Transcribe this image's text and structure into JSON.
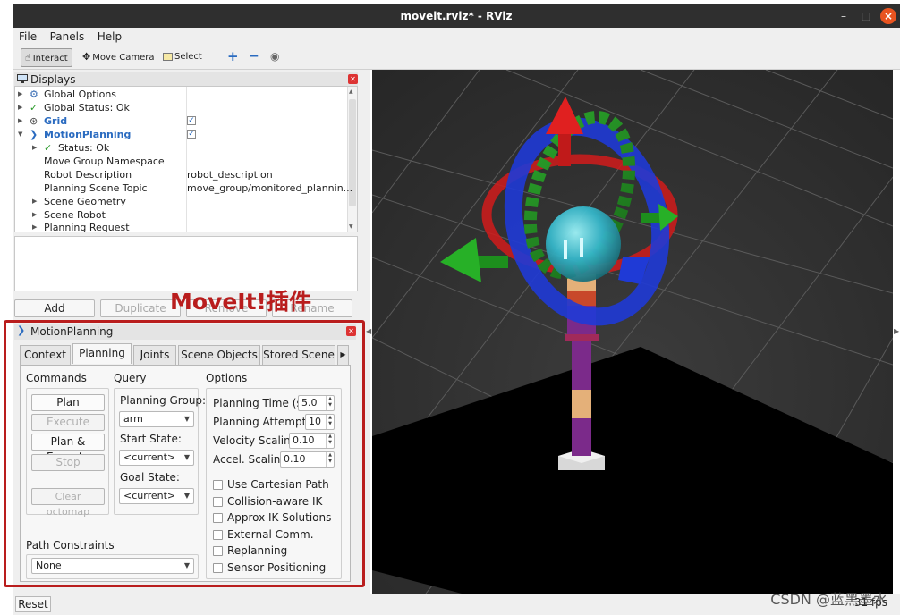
{
  "window": {
    "title": "moveit.rviz* - RViz",
    "minimize": "–",
    "maximize": "□",
    "close": "×"
  },
  "menu": {
    "file": "File",
    "panels": "Panels",
    "help": "Help"
  },
  "toolbar": {
    "interact": "Interact",
    "move_camera": "Move Camera",
    "select": "Select",
    "plus": "+",
    "minus": "−",
    "eye": "◉"
  },
  "displays": {
    "header": "Displays",
    "rows": [
      {
        "label": "Global Options",
        "value": ""
      },
      {
        "label": "Global Status: Ok",
        "value": ""
      },
      {
        "label": "Grid",
        "value": ""
      },
      {
        "label": "MotionPlanning",
        "value": ""
      },
      {
        "label": "Status: Ok",
        "value": ""
      },
      {
        "label": "Move Group Namespace",
        "value": ""
      },
      {
        "label": "Robot Description",
        "value": "robot_description"
      },
      {
        "label": "Planning Scene Topic",
        "value": "move_group/monitored_plannin..."
      },
      {
        "label": "Scene Geometry",
        "value": ""
      },
      {
        "label": "Scene Robot",
        "value": ""
      },
      {
        "label": "Planning Request",
        "value": ""
      }
    ],
    "buttons": {
      "add": "Add",
      "duplicate": "Duplicate",
      "remove": "Remove",
      "rename": "Rename"
    }
  },
  "annotation": "MoveIt!插件",
  "motion_planning": {
    "header": "MotionPlanning",
    "tabs": [
      "Context",
      "Planning",
      "Joints",
      "Scene Objects",
      "Stored Scene"
    ],
    "selected_tab": "Planning",
    "commands": {
      "title": "Commands",
      "plan": "Plan",
      "execute": "Execute",
      "plan_execute": "Plan & Execute",
      "stop": "Stop",
      "clear_octomap": "Clear octomap"
    },
    "query": {
      "title": "Query",
      "planning_group_label": "Planning Group:",
      "planning_group_value": "arm",
      "start_state_label": "Start State:",
      "start_state_value": "<current>",
      "goal_state_label": "Goal State:",
      "goal_state_value": "<current>"
    },
    "options": {
      "title": "Options",
      "planning_time_label": "Planning Time (s):",
      "planning_time_value": "5.0",
      "planning_attempts_label": "Planning Attempts:",
      "planning_attempts_value": "10",
      "velocity_scaling_label": "Velocity Scaling:",
      "velocity_scaling_value": "0.10",
      "accel_scaling_label": "Accel. Scaling:",
      "accel_scaling_value": "0.10",
      "checkboxes": [
        "Use Cartesian Path",
        "Collision-aware IK",
        "Approx IK Solutions",
        "External Comm.",
        "Replanning",
        "Sensor Positioning"
      ]
    },
    "path_constraints": {
      "title": "Path Constraints",
      "value": "None"
    }
  },
  "status": {
    "reset": "Reset",
    "fps": "31 fps"
  },
  "watermark": "CSDN @蓝黑墨水",
  "colors": {
    "titlebar": "#2f2f2f",
    "accent_red": "#b91d1d",
    "viewport": "#303030",
    "link_blue": "#2a6bc0"
  }
}
